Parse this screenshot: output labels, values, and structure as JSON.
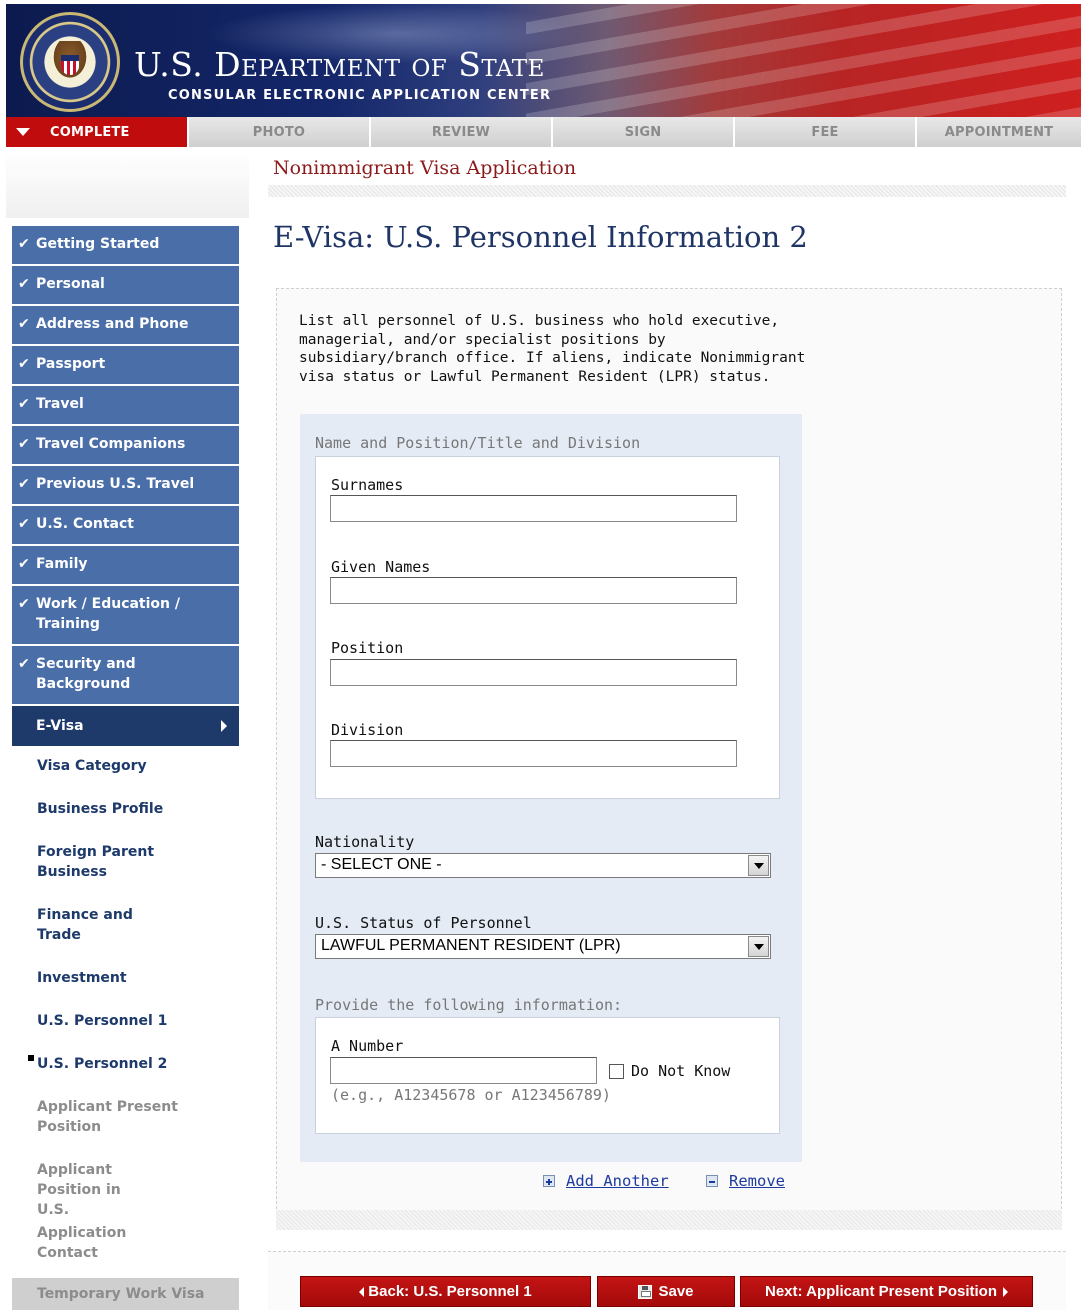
{
  "banner": {
    "title": "U.S. Department of State",
    "subtitle": "CONSULAR ELECTRONIC APPLICATION CENTER"
  },
  "steps": [
    "COMPLETE",
    "PHOTO",
    "REVIEW",
    "SIGN",
    "FEE",
    "APPOINTMENT"
  ],
  "page_header": "Nonimmigrant Visa Application",
  "page_title": "E-Visa: U.S. Personnel Information 2",
  "sidebar": {
    "done_items": [
      "Getting Started",
      "Personal",
      "Address and Phone",
      "Passport",
      "Travel",
      "Travel Companions",
      "Previous U.S. Travel",
      "U.S. Contact",
      "Family",
      "Work / Education / Training",
      "Security and Background"
    ],
    "current_section": "E-Visa",
    "sub_items": [
      "Visa Category",
      "Business Profile",
      "Foreign Parent Business",
      "Finance and Trade",
      "Investment",
      "U.S. Personnel 1",
      "U.S. Personnel 2",
      "Applicant Present Position",
      "Applicant Position in U.S.",
      "Application Contact"
    ],
    "disabled_item": "Temporary Work Visa"
  },
  "form": {
    "intro": "List all personnel of U.S. business who hold executive, managerial, and/or specialist positions by subsidiary/branch office. If aliens, indicate Nonimmigrant visa status or Lawful Permanent Resident (LPR) status.",
    "group_label": "Name and Position/Title and Division",
    "surnames_label": "Surnames",
    "surnames_value": "",
    "given_names_label": "Given Names",
    "given_names_value": "",
    "position_label": "Position",
    "position_value": "",
    "division_label": "Division",
    "division_value": "",
    "nationality_label": "Nationality",
    "nationality_value": "- SELECT ONE -",
    "status_label": "U.S. Status of Personnel",
    "status_value": "LAWFUL PERMANENT RESIDENT (LPR)",
    "provide_label": "Provide the following information:",
    "a_number_label": "A Number",
    "a_number_value": "",
    "do_not_know_label": "Do Not Know",
    "a_number_hint": "(e.g., A12345678 or A123456789)",
    "add_another": "Add Another",
    "remove": "Remove"
  },
  "footer": {
    "back": "Back: U.S. Personnel 1",
    "save": "Save",
    "next": "Next: Applicant Present Position"
  },
  "colors": {
    "accent_red": "#c00c0c",
    "nav_blue": "#4a6ea8",
    "nav_dark": "#1d3a6b",
    "title_blue": "#1f3566",
    "header_red": "#8b1a1a"
  }
}
